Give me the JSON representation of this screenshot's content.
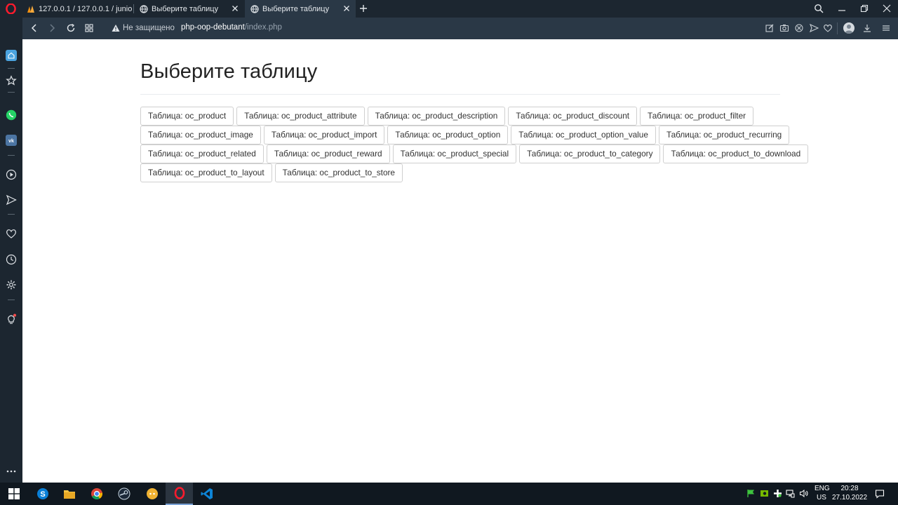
{
  "browser": {
    "tabs": [
      {
        "title": "127.0.0.1 / 127.0.0.1 / junio",
        "active": false
      },
      {
        "title": "Выберите таблицу",
        "active": false
      },
      {
        "title": "Выберите таблицу",
        "active": true
      }
    ],
    "security_label": "Не защищено",
    "url_host": "php-oop-debutant",
    "url_path": "/index.php"
  },
  "page": {
    "heading": "Выберите таблицу",
    "button_rows": [
      [
        "Таблица: oc_product",
        "Таблица: oc_product_attribute",
        "Таблица: oc_product_description",
        "Таблица: oc_product_discount",
        "Таблица: oc_product_filter"
      ],
      [
        "Таблица: oc_product_image",
        "Таблица: oc_product_import",
        "Таблица: oc_product_option",
        "Таблица: oc_product_option_value",
        "Таблица: oc_product_recurring"
      ],
      [
        "Таблица: oc_product_related",
        "Таблица: oc_product_reward",
        "Таблица: oc_product_special",
        "Таблица: oc_product_to_category",
        "Таблица: oc_product_to_download"
      ],
      [
        "Таблица: oc_product_to_layout",
        "Таблица: oc_product_to_store"
      ]
    ]
  },
  "taskbar": {
    "lang_top": "ENG",
    "lang_bottom": "US",
    "time": "20:28",
    "date": "27.10.2022"
  },
  "colors": {
    "chrome_bg": "#1c2630",
    "addressbar_bg": "#2a3846",
    "sidebar_accent": "#4aa3df",
    "whatsapp": "#25d366",
    "vk": "#4c75a3"
  }
}
